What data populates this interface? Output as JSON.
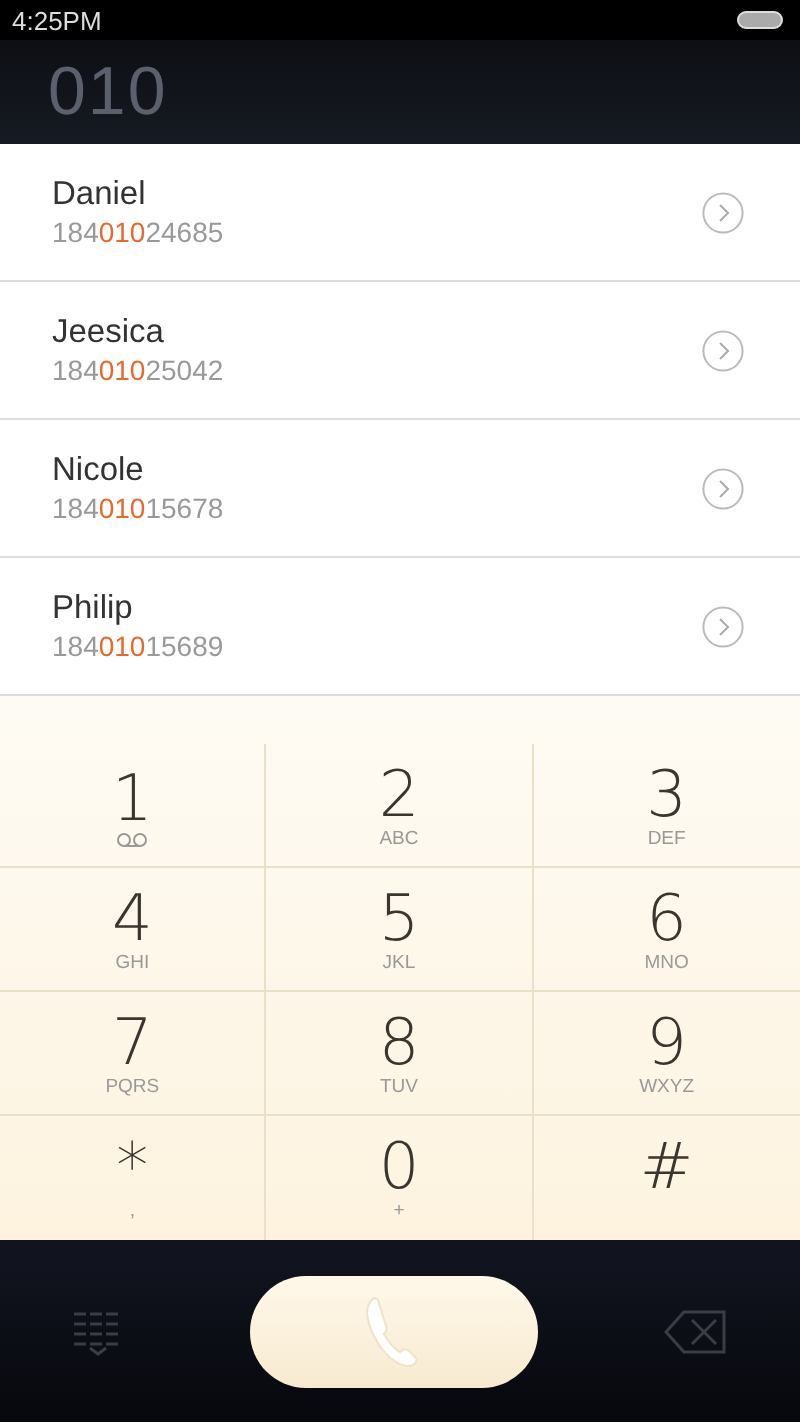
{
  "status_bar": {
    "time": "4:25PM"
  },
  "dialed_number": "010",
  "contacts": [
    {
      "name": "Daniel",
      "number_before": "184",
      "number_match": "010",
      "number_after": "24685"
    },
    {
      "name": "Jeesica",
      "number_before": "184",
      "number_match": "010",
      "number_after": "25042"
    },
    {
      "name": "Nicole",
      "number_before": "184",
      "number_match": "010",
      "number_after": "15678"
    },
    {
      "name": "Philip",
      "number_before": "184",
      "number_match": "010",
      "number_after": "15689"
    }
  ],
  "keypad": [
    {
      "digit": "1",
      "kind": "voicemail"
    },
    {
      "digit": "2",
      "kind": "letters",
      "sub": "ABC"
    },
    {
      "digit": "3",
      "kind": "letters",
      "sub": "DEF"
    },
    {
      "digit": "4",
      "kind": "letters",
      "sub": "GHI"
    },
    {
      "digit": "5",
      "kind": "letters",
      "sub": "JKL"
    },
    {
      "digit": "6",
      "kind": "letters",
      "sub": "MNO"
    },
    {
      "digit": "7",
      "kind": "letters",
      "sub": "PQRS"
    },
    {
      "digit": "8",
      "kind": "letters",
      "sub": "TUV"
    },
    {
      "digit": "9",
      "kind": "letters",
      "sub": "WXYZ"
    },
    {
      "digit": "*",
      "kind": "letters",
      "sub": ","
    },
    {
      "digit": "0",
      "kind": "letters",
      "sub": "+"
    },
    {
      "digit": "#",
      "kind": "plain"
    }
  ]
}
